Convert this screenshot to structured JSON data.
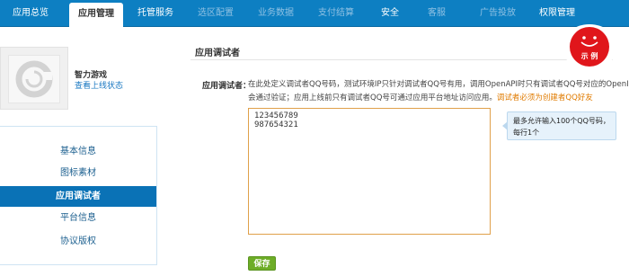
{
  "nav": {
    "tabs": [
      {
        "label": "应用总览"
      },
      {
        "label": "应用管理"
      },
      {
        "label": "托管服务"
      },
      {
        "label": "选区配置"
      },
      {
        "label": "业务数据"
      },
      {
        "label": "支付结算"
      },
      {
        "label": "安全"
      },
      {
        "label": "客服"
      },
      {
        "label": "广告投放"
      },
      {
        "label": "权限管理"
      }
    ]
  },
  "app": {
    "name": "智力游戏",
    "status_link": "查看上线状态"
  },
  "sidebar": {
    "items": [
      {
        "label": "基本信息"
      },
      {
        "label": "图标素材"
      },
      {
        "label": "应用调试者"
      },
      {
        "label": "平台信息"
      },
      {
        "label": "协议版权"
      }
    ]
  },
  "main": {
    "title": "应用调试者",
    "field_label": "应用调试者：",
    "desc_line1": "在此处定义调试者QQ号码，测试环境IP只针对调试者QQ号有用，调用OpenAPI时只有调试者QQ号对应的OpenID",
    "desc_line2": "会通过验证；应用上线前只有调试者QQ号可通过应用平台地址访问应用。",
    "desc_highlight": "调试者必须为创建者QQ好友",
    "qq_value": "123456789\n987654321",
    "tip": "最多允许输入100个QQ号码，每行1个",
    "save_label": "保存"
  },
  "badge": {
    "label": "示 例"
  },
  "colors": {
    "nav_bg": "#0d7fc2",
    "active_side": "#0a72b6",
    "highlight": "#e07b00",
    "save": "#6dad27",
    "badge": "#e0161b"
  }
}
